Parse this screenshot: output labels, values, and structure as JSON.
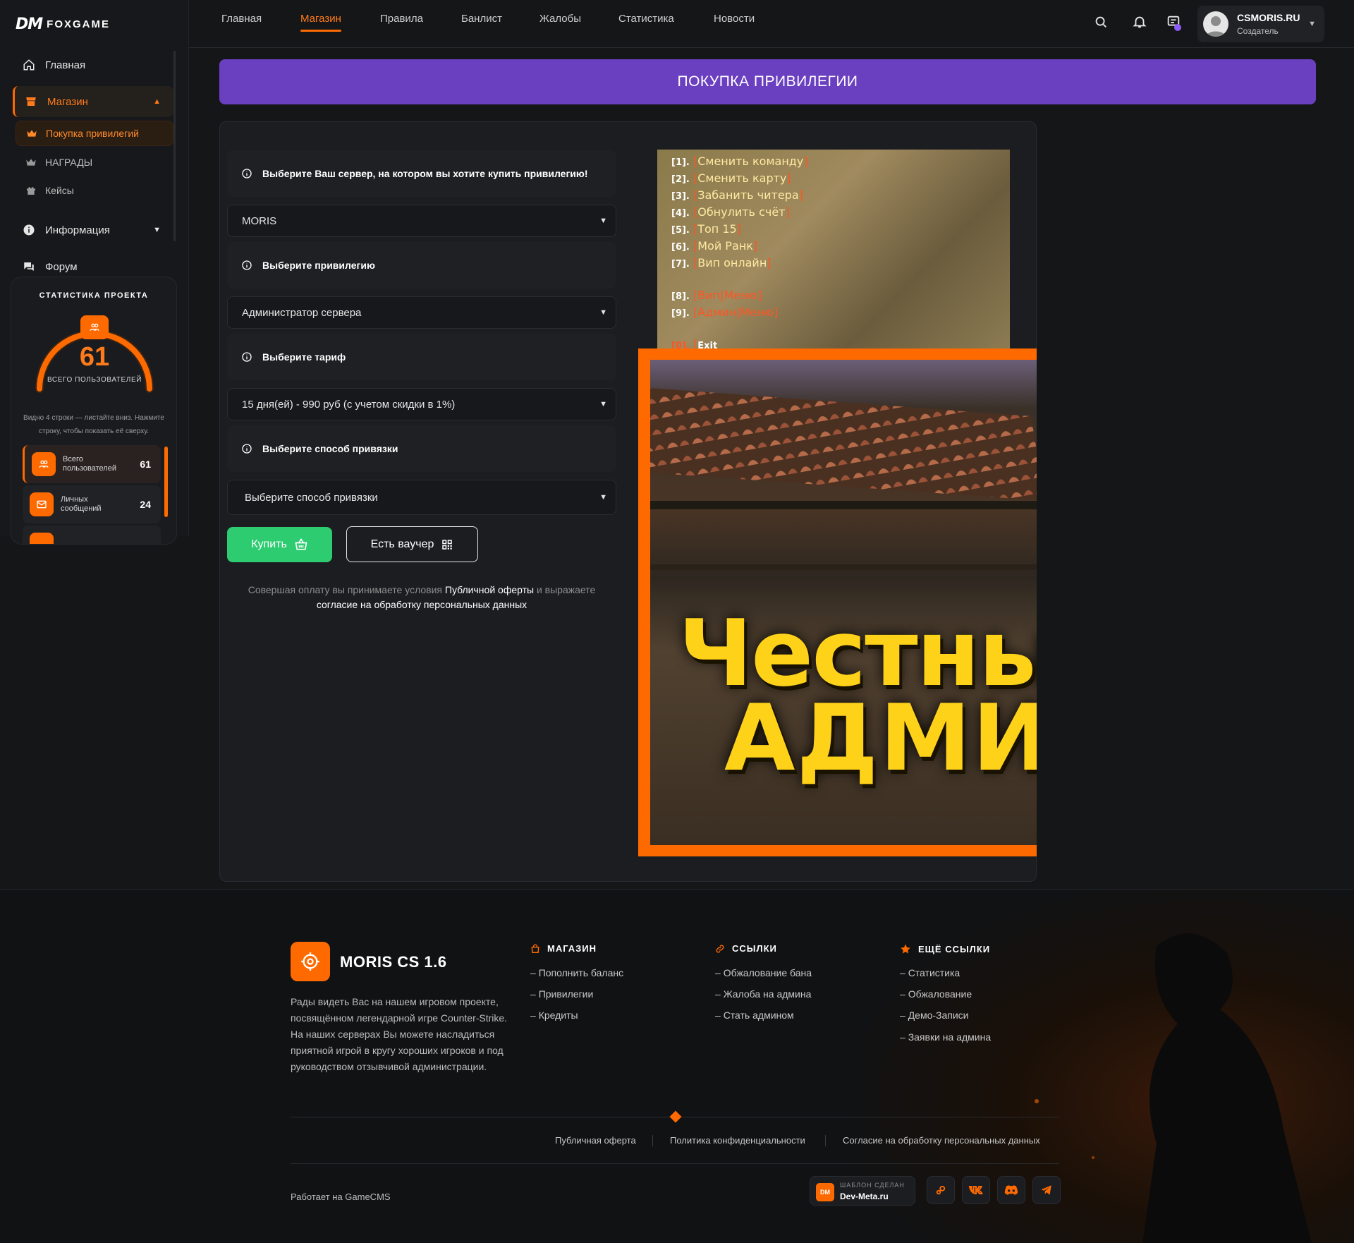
{
  "brand": {
    "logo_dm": "DM",
    "logo_name": "FOXGAME"
  },
  "sidebar": {
    "items": [
      {
        "label": "Главная"
      },
      {
        "label": "Магазин"
      },
      {
        "label": "Информация"
      },
      {
        "label": "Форум"
      }
    ],
    "shop_sub": [
      {
        "label": "Покупка привилегий"
      },
      {
        "label": "НАГРАДЫ"
      },
      {
        "label": "Кейсы"
      }
    ]
  },
  "stats": {
    "title": "СТАТИСТИКА ПРОЕКТА",
    "gauge_value": "61",
    "gauge_label": "ВСЕГО ПОЛЬЗОВАТЕЛЕЙ",
    "hint": "Видно 4 строки — листайте вниз. Нажмите строку, чтобы показать её сверху.",
    "rows": [
      {
        "label": "Всего пользователей",
        "value": "61"
      },
      {
        "label": "Личных сообщений",
        "value": "24"
      }
    ]
  },
  "topnav": {
    "items": [
      {
        "label": "Главная"
      },
      {
        "label": "Магазин"
      },
      {
        "label": "Правила"
      },
      {
        "label": "Банлист"
      },
      {
        "label": "Жалобы"
      },
      {
        "label": "Статистика"
      },
      {
        "label": "Новости"
      }
    ],
    "active": "Магазин"
  },
  "user": {
    "name": "CSMORIS.RU",
    "role": "Создатель"
  },
  "page": {
    "banner": "ПОКУПКА ПРИВИЛЕГИИ"
  },
  "form": {
    "server_hint": "Выберите Ваш сервер, на котором вы хотите купить привилегию!",
    "server_value": "MORIS",
    "privilege_hint": "Выберите привилегию",
    "privilege_value": "Администратор сервера",
    "tariff_hint": "Выберите тариф",
    "tariff_value": "15 дня(ей) - 990 руб (с учетом скидки в 1%)",
    "binding_hint": "Выберите способ привязки",
    "binding_value": "Выберите способ привязки",
    "buy_label": "Купить",
    "voucher_label": "Есть ваучер",
    "terms_prefix": "Совершая оплату вы принимаете условия",
    "terms_link1": "Публичной оферты",
    "terms_mid": "и выражаете",
    "terms_link2": "согласие на обработку персональных данных"
  },
  "menu_preview": {
    "lines": [
      {
        "n": "[1].",
        "t": "Сменить команду"
      },
      {
        "n": "[2].",
        "t": "Сменить карту"
      },
      {
        "n": "[3].",
        "t": "Забанить читера"
      },
      {
        "n": "[4].",
        "t": "Обнулить счёт"
      },
      {
        "n": "[5].",
        "t": "Топ 15"
      },
      {
        "n": "[6].",
        "t": "Мой Ранк"
      },
      {
        "n": "[7].",
        "t": "Вип онлайн"
      },
      {
        "n": "[8].",
        "t": "Вип|Меню"
      },
      {
        "n": "[9].",
        "t": "Админ|Меню"
      },
      {
        "n": "[0].",
        "t": "Exit"
      }
    ]
  },
  "thumbnail": {
    "line1": "Честны",
    "line2": "АДМИН"
  },
  "footer": {
    "brand": "MORIS CS 1.6",
    "description": "Рады видеть Вас на нашем игровом проекте, посвящённом легендарной игре Counter-Strike. На наших серверах Вы можете насладиться приятной игрой в кругу хороших игроков и под руководством отзывчивой администрации.",
    "shop_title": "МАГАЗИН",
    "shop_links": [
      "Пополнить баланс",
      "Привилегии",
      "Кредиты"
    ],
    "links_title": "ССЫЛКИ",
    "links": [
      "Обжалование бана",
      "Жалоба на админа",
      "Стать админом"
    ],
    "more_title": "ЕЩЁ ССЫЛКИ",
    "more_links": [
      "Статистика",
      "Обжалование",
      "Демо-Записи",
      "Заявки на админа"
    ],
    "bottom_links": [
      "Публичная оферта",
      "Политика конфиденциальности",
      "Согласие на обработку персональных данных"
    ],
    "powered": "Работает на GameCMS",
    "made_by_label": "ШАБЛОН СДЕЛАН",
    "made_by_site": "Dev-Meta.ru",
    "made_by_icon": "DM",
    "socials": [
      "steam-icon",
      "vk-icon",
      "discord-icon",
      "telegram-icon"
    ]
  },
  "colors": {
    "accent": "#ff6a00",
    "banner": "#6a3fc0",
    "buy": "#2ecc71",
    "bg": "#151618"
  }
}
